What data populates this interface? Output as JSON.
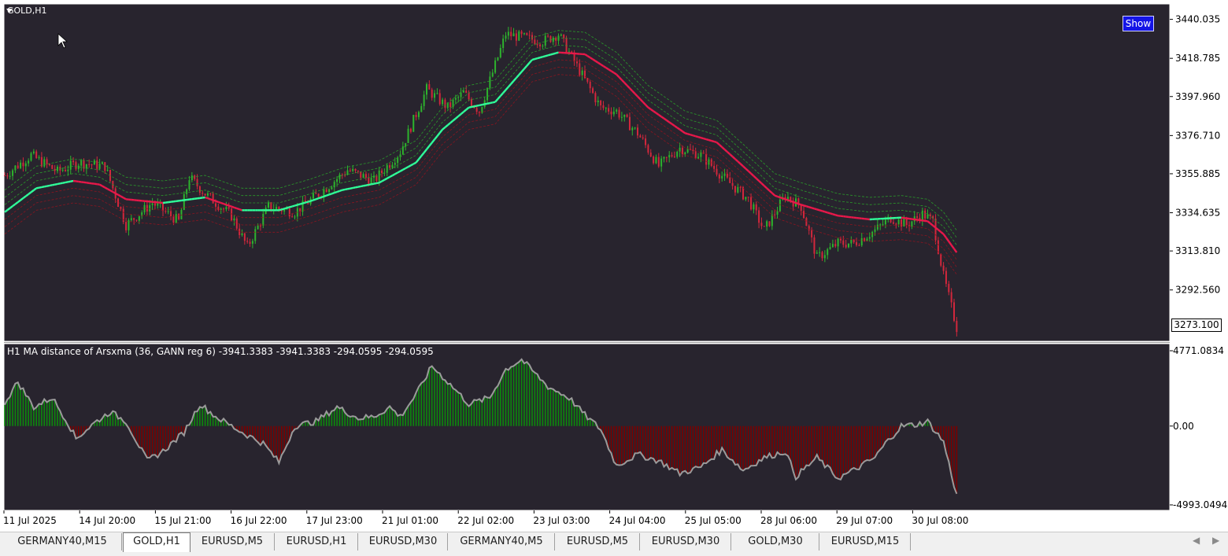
{
  "window": {
    "symbol_label": "GOLD,H1",
    "show_button": "Show",
    "current_price": "3273.100"
  },
  "colors": {
    "background": "#28242e",
    "bull_candle": "#2db32d",
    "bear_candle": "#d2273c",
    "ma_up": "#30ff9a",
    "ma_down": "#e8184a",
    "band_upper": "#2a9a2a",
    "band_lower": "#8a1520",
    "hist_pos": "#0c8a0c",
    "hist_neg": "#7a0000",
    "osc_line": "#9a9a9a"
  },
  "price_axis": {
    "labels": [
      "3440.035",
      "3418.785",
      "3397.960",
      "3376.710",
      "3355.885",
      "3334.635",
      "3313.810",
      "3292.560"
    ],
    "min": 3265,
    "max": 3448
  },
  "indicator": {
    "label": "H1 MA distance of Arsxma (36, GANN reg 6) -3941.3383 -3941.3383 -294.0595 -294.0595",
    "axis_labels": [
      "4771.0834",
      "0.00",
      "-4993.0494"
    ]
  },
  "time_axis": {
    "labels": [
      "11 Jul 2025",
      "14 Jul 20:00",
      "15 Jul 21:00",
      "16 Jul 22:00",
      "17 Jul 23:00",
      "21 Jul 01:00",
      "22 Jul 02:00",
      "23 Jul 03:00",
      "24 Jul 04:00",
      "25 Jul 05:00",
      "28 Jul 06:00",
      "29 Jul 07:00",
      "30 Jul 08:00"
    ]
  },
  "chart_data": {
    "type": "candlestick",
    "title": "GOLD,H1",
    "ylim": [
      3265,
      3448
    ],
    "close_keypoints": [
      [
        0,
        3355
      ],
      [
        10,
        3366
      ],
      [
        20,
        3357
      ],
      [
        28,
        3362
      ],
      [
        38,
        3360
      ],
      [
        46,
        3328
      ],
      [
        56,
        3340
      ],
      [
        66,
        3330
      ],
      [
        70,
        3354
      ],
      [
        76,
        3345
      ],
      [
        86,
        3333
      ],
      [
        92,
        3316
      ],
      [
        100,
        3338
      ],
      [
        110,
        3335
      ],
      [
        120,
        3346
      ],
      [
        130,
        3358
      ],
      [
        140,
        3352
      ],
      [
        150,
        3368
      ],
      [
        160,
        3402
      ],
      [
        168,
        3392
      ],
      [
        174,
        3400
      ],
      [
        180,
        3390
      ],
      [
        190,
        3432
      ],
      [
        204,
        3428
      ],
      [
        210,
        3432
      ],
      [
        218,
        3412
      ],
      [
        226,
        3392
      ],
      [
        232,
        3390
      ],
      [
        240,
        3378
      ],
      [
        248,
        3360
      ],
      [
        256,
        3370
      ],
      [
        264,
        3366
      ],
      [
        274,
        3352
      ],
      [
        282,
        3342
      ],
      [
        288,
        3325
      ],
      [
        296,
        3344
      ],
      [
        302,
        3338
      ],
      [
        308,
        3310
      ],
      [
        316,
        3318
      ],
      [
        322,
        3318
      ],
      [
        330,
        3325
      ],
      [
        336,
        3332
      ],
      [
        342,
        3328
      ],
      [
        348,
        3334
      ],
      [
        352,
        3330
      ],
      [
        356,
        3300
      ],
      [
        361,
        3272
      ]
    ],
    "ma_keypoints": [
      [
        0,
        3335
      ],
      [
        12,
        3348
      ],
      [
        26,
        3352
      ],
      [
        36,
        3350
      ],
      [
        46,
        3342
      ],
      [
        60,
        3340
      ],
      [
        76,
        3343
      ],
      [
        90,
        3336
      ],
      [
        104,
        3336
      ],
      [
        116,
        3341
      ],
      [
        128,
        3347
      ],
      [
        142,
        3351
      ],
      [
        156,
        3362
      ],
      [
        166,
        3380
      ],
      [
        176,
        3392
      ],
      [
        186,
        3395
      ],
      [
        200,
        3418
      ],
      [
        210,
        3422
      ],
      [
        220,
        3421
      ],
      [
        232,
        3410
      ],
      [
        244,
        3392
      ],
      [
        258,
        3378
      ],
      [
        270,
        3373
      ],
      [
        280,
        3360
      ],
      [
        292,
        3344
      ],
      [
        302,
        3339
      ],
      [
        316,
        3333
      ],
      [
        328,
        3331
      ],
      [
        340,
        3332
      ],
      [
        350,
        3330
      ],
      [
        356,
        3323
      ],
      [
        361,
        3313
      ]
    ],
    "oscillator_keypoints": [
      [
        0,
        1500
      ],
      [
        5,
        2800
      ],
      [
        11,
        1200
      ],
      [
        18,
        1800
      ],
      [
        24,
        200
      ],
      [
        27,
        -800
      ],
      [
        34,
        200
      ],
      [
        40,
        900
      ],
      [
        46,
        300
      ],
      [
        54,
        -2200
      ],
      [
        60,
        -1600
      ],
      [
        68,
        -400
      ],
      [
        74,
        1400
      ],
      [
        80,
        600
      ],
      [
        90,
        -400
      ],
      [
        98,
        -1100
      ],
      [
        104,
        -2300
      ],
      [
        110,
        0
      ],
      [
        118,
        300
      ],
      [
        126,
        1200
      ],
      [
        134,
        500
      ],
      [
        140,
        600
      ],
      [
        146,
        1200
      ],
      [
        150,
        600
      ],
      [
        156,
        2000
      ],
      [
        162,
        3800
      ],
      [
        168,
        2800
      ],
      [
        176,
        1400
      ],
      [
        184,
        1800
      ],
      [
        190,
        3600
      ],
      [
        196,
        4200
      ],
      [
        206,
        2500
      ],
      [
        214,
        1800
      ],
      [
        220,
        700
      ],
      [
        226,
        -200
      ],
      [
        232,
        -2500
      ],
      [
        240,
        -1800
      ],
      [
        248,
        -2200
      ],
      [
        256,
        -3000
      ],
      [
        264,
        -2600
      ],
      [
        272,
        -1500
      ],
      [
        280,
        -2800
      ],
      [
        288,
        -2000
      ],
      [
        296,
        -1600
      ],
      [
        300,
        -3200
      ],
      [
        308,
        -2000
      ],
      [
        316,
        -3300
      ],
      [
        322,
        -2800
      ],
      [
        330,
        -2000
      ],
      [
        334,
        -1100
      ],
      [
        340,
        0
      ],
      [
        346,
        100
      ],
      [
        350,
        300
      ],
      [
        356,
        -1000
      ],
      [
        361,
        -4400
      ]
    ]
  },
  "tabs": [
    {
      "label": "GERMANY40,M15",
      "active": false
    },
    {
      "label": "GOLD,H1",
      "active": true
    },
    {
      "label": "EURUSD,M5",
      "active": false
    },
    {
      "label": "EURUSD,H1",
      "active": false
    },
    {
      "label": "EURUSD,M30",
      "active": false
    },
    {
      "label": "GERMANY40,M5",
      "active": false
    },
    {
      "label": "EURUSD,M5",
      "active": false
    },
    {
      "label": "EURUSD,M30",
      "active": false
    },
    {
      "label": "GOLD,M30",
      "active": false
    },
    {
      "label": "EURUSD,M15",
      "active": false
    }
  ],
  "tab_nav": {
    "left": "◀",
    "right": "▶"
  }
}
